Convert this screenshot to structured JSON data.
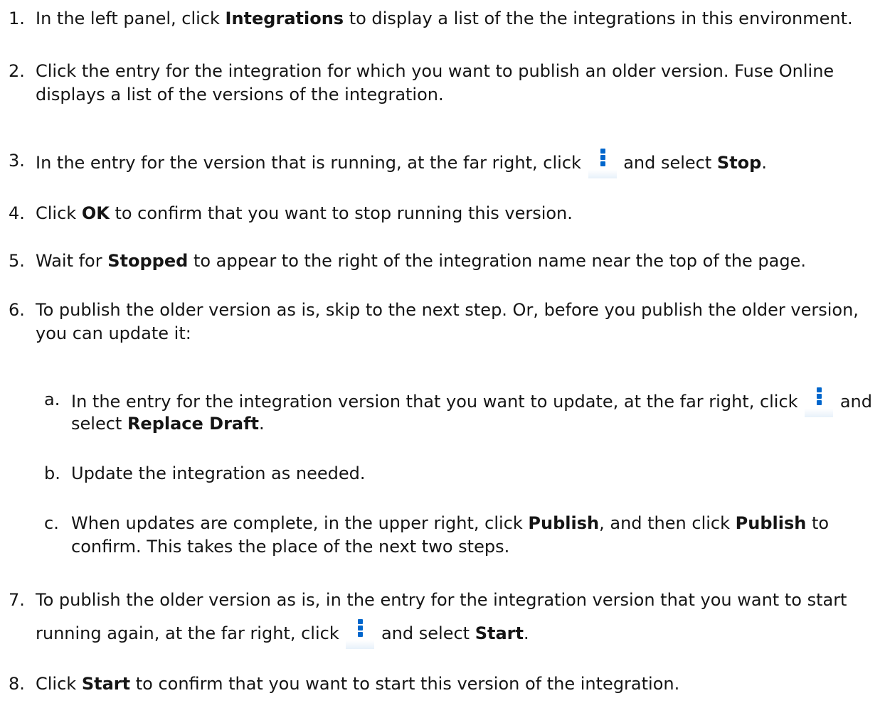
{
  "steps": [
    {
      "num": "1.",
      "parts": [
        "In the left panel, click ",
        "Integrations",
        " to display a list of the the integrations in this environment."
      ]
    },
    {
      "num": "2.",
      "lines": [
        "Click the entry for the integration for which you want to publish an older version. Fuse Online",
        "displays a list of the versions of the integration."
      ]
    },
    {
      "num": "3.",
      "parts": [
        "In the entry for the version that is running, at the far right, click ",
        " and select ",
        "Stop",
        "."
      ]
    },
    {
      "num": "4.",
      "parts": [
        "Click ",
        "OK",
        " to confirm that you want to stop running this version."
      ]
    },
    {
      "num": "5.",
      "parts": [
        "Wait for ",
        "Stopped",
        " to appear to the right of the integration name near the top of the page."
      ]
    },
    {
      "num": "6.",
      "lines": [
        "To publish the older version as is, skip to the next step. Or, before you publish the older version,",
        "you can update it:"
      ],
      "substeps": [
        {
          "num": "a.",
          "parts": [
            "In the entry for the integration version that you want to update, at the far right, click ",
            " and",
            "select ",
            "Replace Draft",
            "."
          ]
        },
        {
          "num": "b.",
          "text": "Update the integration as needed."
        },
        {
          "num": "c.",
          "parts": [
            "When updates are complete, in the upper right, click ",
            "Publish",
            ", and then click ",
            "Publish",
            " to",
            "confirm. This takes the place of the next two steps."
          ]
        }
      ]
    },
    {
      "num": "7.",
      "parts": [
        "To publish the older version as is, in the entry for the integration version that you want to start",
        "running again, at the far right, click ",
        " and select ",
        "Start",
        "."
      ]
    },
    {
      "num": "8.",
      "parts": [
        "Click ",
        "Start",
        " to confirm that you want to start this version of the integration."
      ]
    }
  ],
  "icons": {
    "kebab": "kebab-menu-icon",
    "kebab_color": "#0066cc"
  }
}
